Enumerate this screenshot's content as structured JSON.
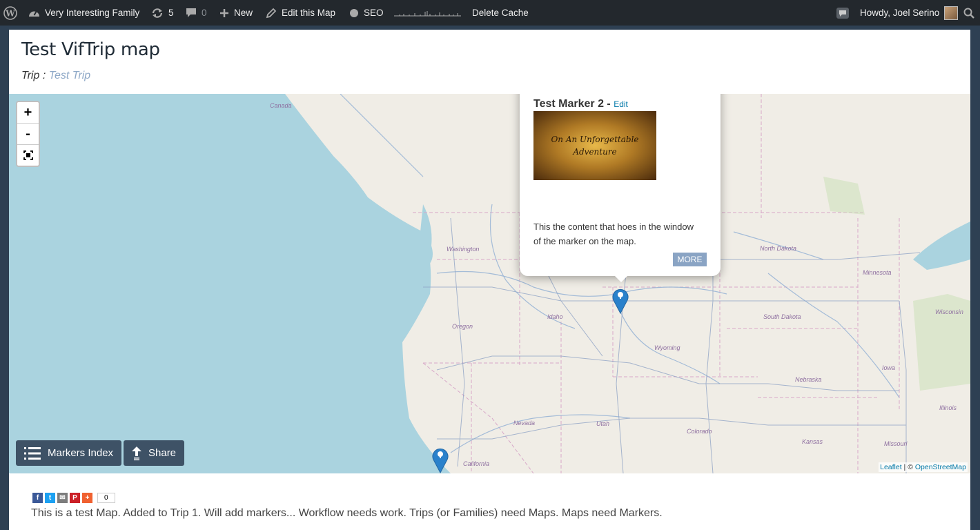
{
  "admin_bar": {
    "site_name": "Very Interesting Family",
    "updates_count": "5",
    "comments_count": "0",
    "new_label": "New",
    "edit_label": "Edit this Map",
    "seo_label": "SEO",
    "delete_cache_label": "Delete Cache",
    "greeting": "Howdy, Joel Serino",
    "icons": [
      "wordpress-icon",
      "dashboard-icon",
      "updates-icon",
      "comments-icon",
      "plus-icon",
      "pencil-icon",
      "seo-icon",
      "notification-icon",
      "search-icon"
    ]
  },
  "page": {
    "title": "Test VifTrip map",
    "trip_prefix": "Trip : ",
    "trip_link": "Test Trip"
  },
  "map": {
    "zoom_in": "+",
    "zoom_out": "-",
    "fullscreen_icon": "fullscreen-icon",
    "labels": {
      "canada": "Canada",
      "washington": "Washington",
      "oregon": "Oregon",
      "idaho": "Idaho",
      "nevada": "Nevada",
      "utah": "Utah",
      "california": "California",
      "wyoming": "Wyoming",
      "colorado": "Colorado",
      "north_dakota": "North Dakota",
      "south_dakota": "South Dakota",
      "nebraska": "Nebraska",
      "kansas": "Kansas",
      "minnesota": "Minnesota",
      "iowa": "Iowa",
      "wisconsin": "Wisconsin",
      "illinois": "Illinois",
      "missouri": "Missouri"
    },
    "markers_index_label": "Markers Index",
    "share_label": "Share",
    "attribution": {
      "leaflet": "Leaflet",
      "separator": " | © ",
      "osm": "OpenStreetMap"
    },
    "popup": {
      "title": "Test Marker 2 - ",
      "edit_label": "Edit",
      "image_text_line1": "On An Unforgettable",
      "image_text_line2": "Adventure",
      "content": "This the content that hoes in the window of the marker on the map.",
      "more_label": "MORE"
    },
    "colors": {
      "water": "#aad3df",
      "land": "#f0ede6",
      "marker": "#2a81cb",
      "button": "#3e5266"
    }
  },
  "share_bar": {
    "facebook": "f",
    "twitter": "t",
    "email": "✉",
    "pinterest": "P",
    "plus": "+",
    "count": "0"
  },
  "description": "This is a test Map. Added to Trip 1. Will add markers...   Workflow needs work. Trips (or Families) need Maps. Maps need Markers."
}
